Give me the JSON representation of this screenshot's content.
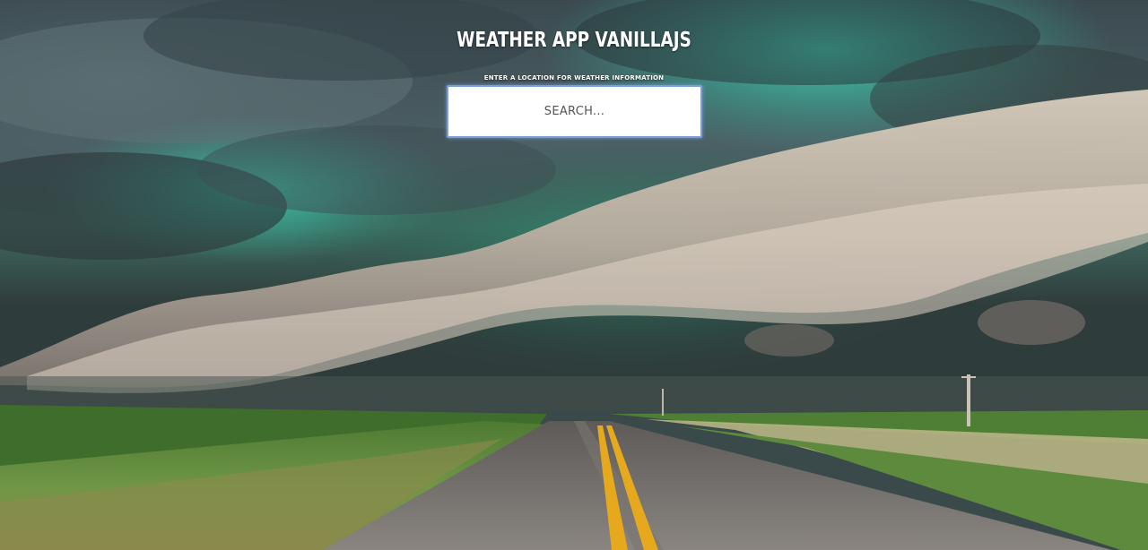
{
  "app": {
    "title": "WEATHER APP VANILLAJS"
  },
  "search": {
    "hint": "ENTER A LOCATION FOR WEATHER INFORMATION",
    "placeholder": "SEARCH...",
    "value": ""
  },
  "background": {
    "description_icon": "storm-landscape-photo",
    "colors": {
      "sky_dark": "#2f3b3f",
      "sky_teal": "#2fc7a8",
      "cloud_light": "#cbbfb0",
      "grass": "#5f8f3a",
      "road": "#6e6a66",
      "road_line": "#e6a81d"
    }
  }
}
